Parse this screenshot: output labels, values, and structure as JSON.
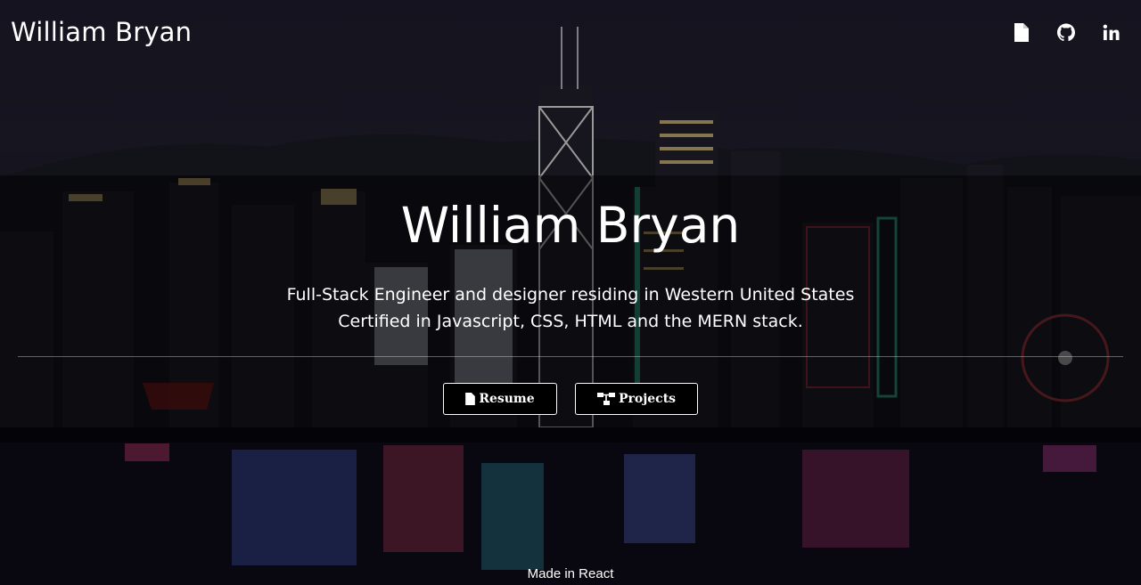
{
  "header": {
    "brand": "William Bryan",
    "icons": [
      "file-icon",
      "github-icon",
      "linkedin-icon"
    ]
  },
  "hero": {
    "title": "William Bryan",
    "tagline_line1": "Full-Stack Engineer and designer residing in Western United States",
    "tagline_line2": "Certified in Javascript, CSS, HTML and the MERN stack.",
    "buttons": {
      "resume": "Resume",
      "projects": "Projects"
    }
  },
  "footer": {
    "text": "Made in React"
  },
  "colors": {
    "text": "#ffffff",
    "button_bg": "#000000",
    "hero_band": "rgba(0,0,0,0.45)"
  }
}
